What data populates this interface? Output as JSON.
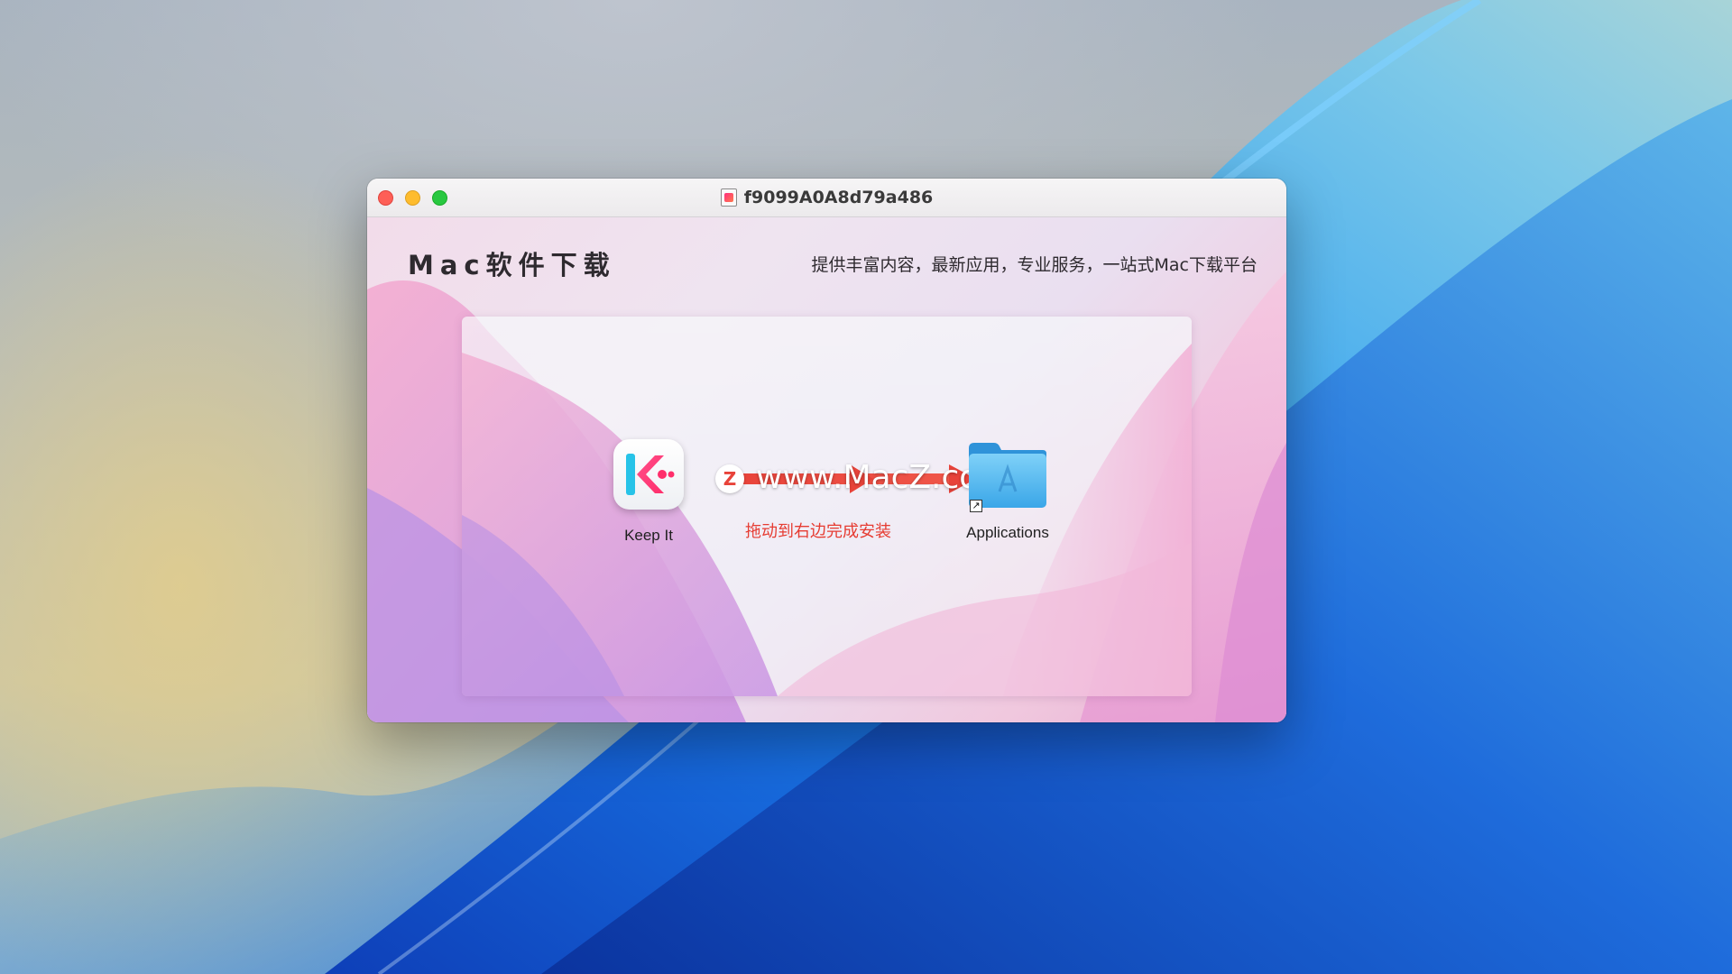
{
  "window": {
    "title": "f9099A0A8d79a486",
    "controls": {
      "close": "close",
      "minimize": "minimize",
      "zoom": "zoom"
    }
  },
  "header": {
    "brand": "Mac软件下载",
    "tagline": "提供丰富内容，最新应用，专业服务，一站式Mac下载平台"
  },
  "installer": {
    "app_name": "Keep It",
    "target_name": "Applications",
    "watermark": "www.MacZ.com",
    "badge_letter": "Z",
    "hint": "拖动到右边完成安装"
  },
  "colors": {
    "accent": "#e63c32",
    "folder": "#4fb4ee",
    "keepit_pink": "#ff2e7e"
  },
  "icons": [
    "disk-image-icon",
    "keep-it-app-icon",
    "arrow-icon",
    "applications-folder-icon",
    "alias-arrow-icon"
  ]
}
